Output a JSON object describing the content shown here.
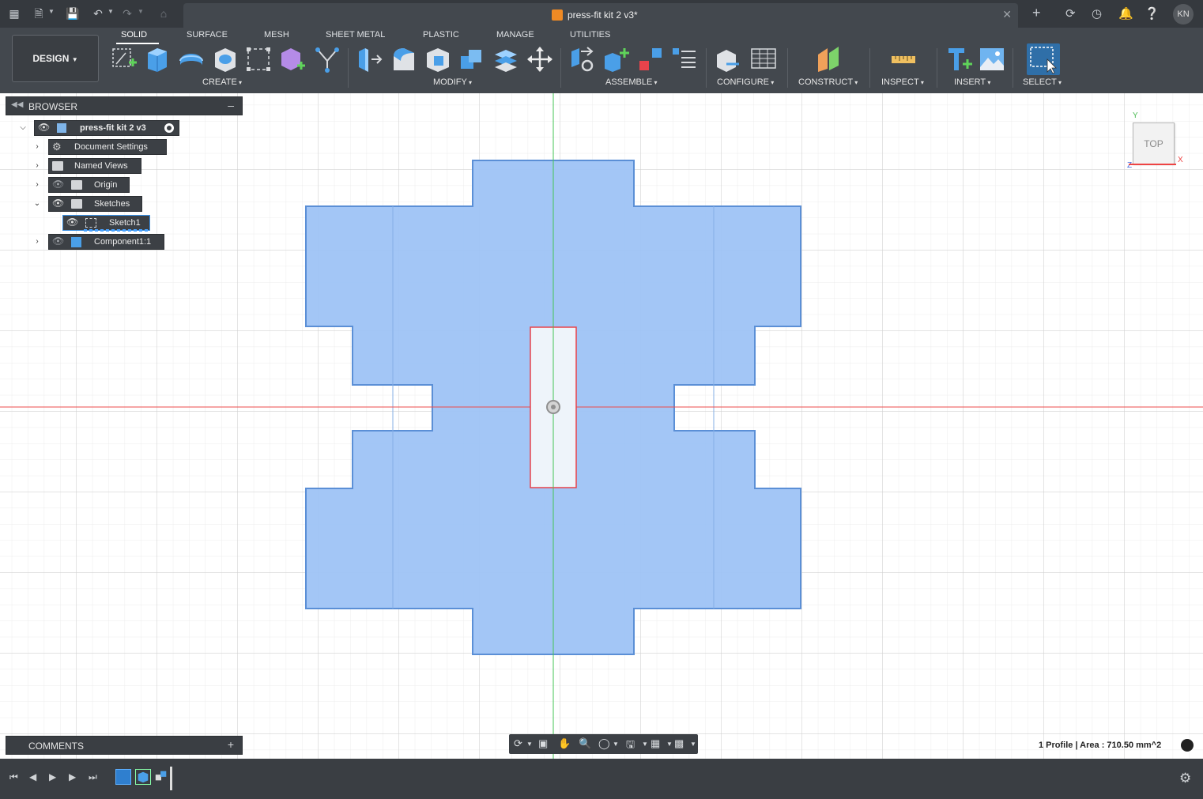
{
  "app": {
    "document_title": "press-fit kit 2 v3*",
    "user_initials": "KN"
  },
  "toolbar": {
    "workspace_button": "DESIGN",
    "tabs": [
      "SOLID",
      "SURFACE",
      "MESH",
      "SHEET METAL",
      "PLASTIC",
      "MANAGE",
      "UTILITIES"
    ],
    "active_tab": "SOLID",
    "groups": [
      "CREATE",
      "MODIFY",
      "ASSEMBLE",
      "CONFIGURE",
      "CONSTRUCT",
      "INSPECT",
      "INSERT",
      "SELECT"
    ]
  },
  "browser": {
    "title": "BROWSER",
    "root": "press-fit kit 2 v3",
    "items": [
      {
        "label": "Document Settings",
        "icon": "gear-icon"
      },
      {
        "label": "Named Views",
        "icon": "folder-icon"
      },
      {
        "label": "Origin",
        "icon": "folder-icon"
      },
      {
        "label": "Sketches",
        "icon": "folder-icon"
      },
      {
        "label": "Sketch1",
        "icon": "sketch-icon"
      },
      {
        "label": "Component1:1",
        "icon": "component-icon"
      }
    ]
  },
  "comments": {
    "title": "COMMENTS"
  },
  "viewcube": {
    "face": "TOP",
    "axis_x": "X",
    "axis_y": "Y",
    "axis_z": "Z"
  },
  "status": {
    "text": "1 Profile | Area : 710.50 mm^2"
  },
  "colors": {
    "profile_fill": "#9ec3f6",
    "profile_stroke": "#5b8fd6",
    "sketch_line_red": "#e8434b",
    "axis_green": "#44c455",
    "axis_red": "#e44"
  }
}
